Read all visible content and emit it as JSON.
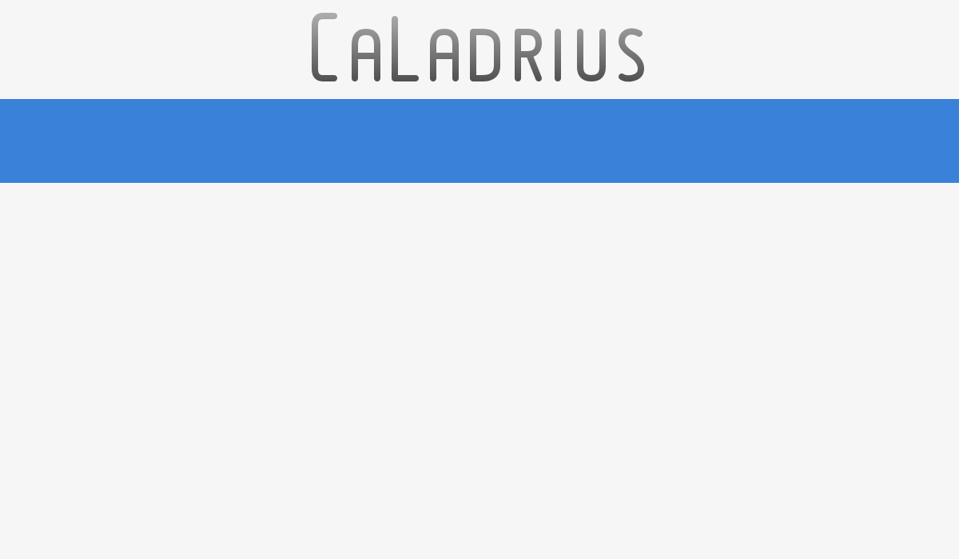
{
  "header": {
    "logo_text": "Caladrius"
  },
  "colors": {
    "page_background": "#f6f6f6",
    "nav_bar": "#3981d9",
    "logo_gradient_top": "#b0b0b0",
    "logo_gradient_bottom": "#505050"
  }
}
